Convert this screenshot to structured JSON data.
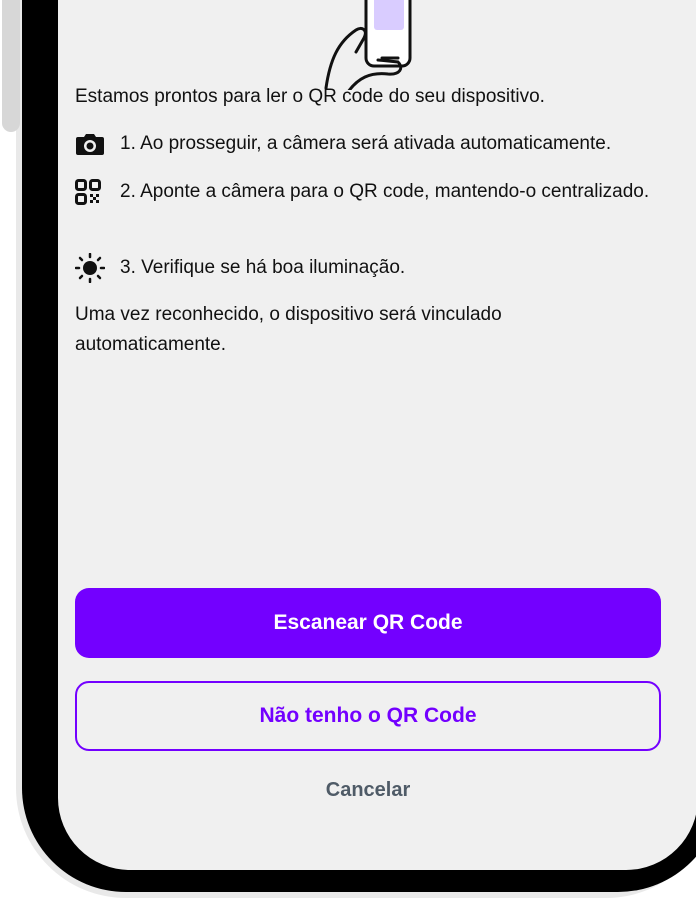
{
  "intro": "Estamos prontos para ler o QR code do seu dispositivo.",
  "steps": [
    {
      "icon": "camera-icon",
      "text": "1. Ao prosseguir, a câmera será ativada automaticamente."
    },
    {
      "icon": "qr-code-icon",
      "text": "2. Aponte a câmera para o QR code, mantendo-o centralizado."
    },
    {
      "icon": "sun-icon",
      "text": "3. Verifique se há boa iluminação."
    }
  ],
  "outro": "Uma vez reconhecido, o dispositivo será vinculado automaticamente.",
  "buttons": {
    "scan": "Escanear QR Code",
    "no_qr": "Não tenho o QR Code",
    "cancel": "Cancelar"
  },
  "colors": {
    "accent": "#7300ff",
    "screen_bg": "#f0f0f0",
    "frame": "#000000",
    "cancel_text": "#4f5b67"
  }
}
